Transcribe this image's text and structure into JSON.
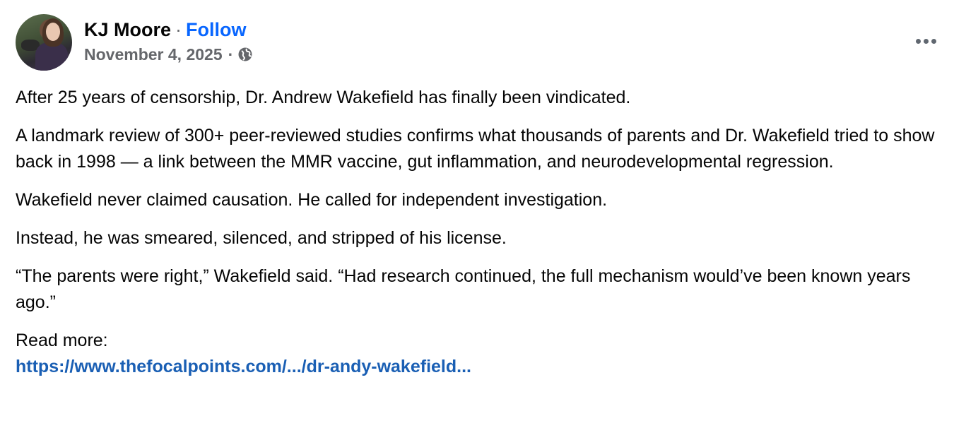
{
  "author": {
    "name": "KJ Moore",
    "separator": "·",
    "follow_label": "Follow",
    "date": "November 4, 2025",
    "date_separator": "·",
    "audience_icon": "globe-icon"
  },
  "menu_icon": "more-options-icon",
  "post": {
    "paragraphs": [
      "After 25 years of censorship, Dr. Andrew Wakefield has finally been vindicated.",
      "A landmark review of 300+ peer-reviewed studies confirms what thousands of parents and Dr. Wakefield tried to show back in 1998 — a link between the MMR vaccine, gut inflammation, and neurodevelopmental regression.",
      "Wakefield never claimed causation. He called for independent investigation.",
      "Instead, he was smeared, silenced, and stripped of his license.",
      "“The parents were right,” Wakefield said. “Had research continued, the full mechanism would’ve been known years ago.”"
    ],
    "read_more_label": "Read more:",
    "link_text": "https://www.thefocalpoints.com/.../dr-andy-wakefield..."
  },
  "colors": {
    "text": "#050505",
    "secondary": "#65676b",
    "follow": "#0866ff",
    "link": "#1a5fb4"
  }
}
